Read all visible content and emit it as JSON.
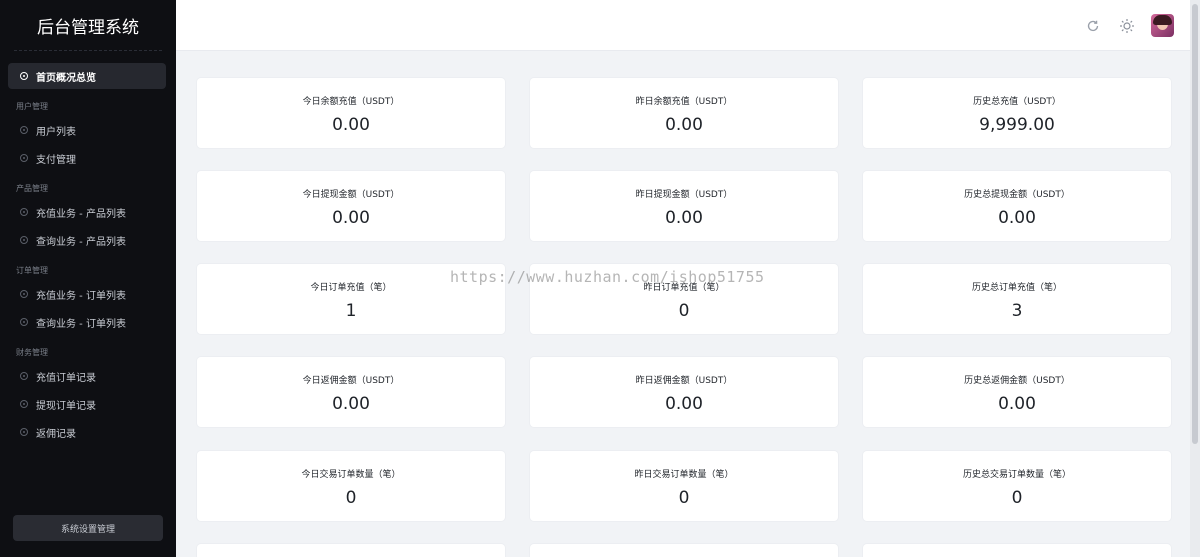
{
  "app": {
    "title": "后台管理系统"
  },
  "sidebar": {
    "active": {
      "label": "首页概况总览"
    },
    "groups": [
      {
        "title": "用户管理",
        "items": [
          "用户列表",
          "支付管理"
        ]
      },
      {
        "title": "产品管理",
        "items": [
          "充值业务 - 产品列表",
          "查询业务 - 产品列表"
        ]
      },
      {
        "title": "订单管理",
        "items": [
          "充值业务 - 订单列表",
          "查询业务 - 订单列表"
        ]
      },
      {
        "title": "财务管理",
        "items": [
          "充值订单记录",
          "提现订单记录",
          "返佣记录"
        ]
      }
    ],
    "settings_button": "系统设置管理"
  },
  "header": {
    "icons": [
      "refresh-icon",
      "theme-sun-icon",
      "user-avatar"
    ]
  },
  "cards": [
    {
      "label": "今日余额充值（USDT）",
      "value": "0.00"
    },
    {
      "label": "昨日余额充值（USDT）",
      "value": "0.00"
    },
    {
      "label": "历史总充值（USDT）",
      "value": "9,999.00"
    },
    {
      "label": "今日提现金额（USDT）",
      "value": "0.00"
    },
    {
      "label": "昨日提现金额（USDT）",
      "value": "0.00"
    },
    {
      "label": "历史总提现金额（USDT）",
      "value": "0.00"
    },
    {
      "label": "今日订单充值（笔）",
      "value": "1"
    },
    {
      "label": "昨日订单充值（笔）",
      "value": "0"
    },
    {
      "label": "历史总订单充值（笔）",
      "value": "3"
    },
    {
      "label": "今日返佣金额（USDT）",
      "value": "0.00"
    },
    {
      "label": "昨日返佣金额（USDT）",
      "value": "0.00"
    },
    {
      "label": "历史总返佣金额（USDT）",
      "value": "0.00"
    },
    {
      "label": "今日交易订单数量（笔）",
      "value": "0"
    },
    {
      "label": "昨日交易订单数量（笔）",
      "value": "0"
    },
    {
      "label": "历史总交易订单数量（笔）",
      "value": "0"
    }
  ],
  "watermark": "https://www.huzhan.com/ishop51755"
}
